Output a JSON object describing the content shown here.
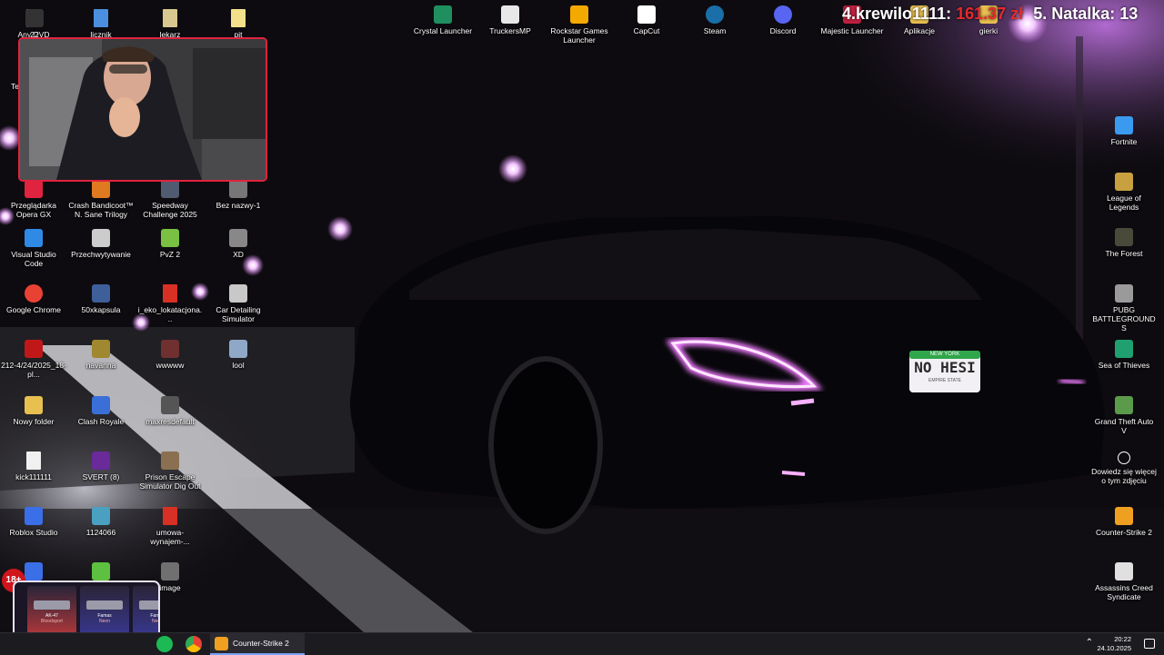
{
  "desktop": {
    "left_icons": [
      {
        "label": "Any DVD",
        "icon": "file-icon",
        "color": "#e8e8e8"
      },
      {
        "label": "licznik",
        "icon": "file-icon",
        "color": "#4a8fe0"
      },
      {
        "label": "lekarz",
        "icon": "file-icon",
        "color": "#d8c890"
      },
      {
        "label": "pit",
        "icon": "file-icon",
        "color": "#f2e18a"
      },
      {
        "label": "22",
        "icon": "image-icon",
        "color": "#333333"
      },
      {
        "label": "Przeglądarka Opera GX",
        "icon": "opera-gx-icon",
        "color": "#e0233e"
      },
      {
        "label": "Crash Bandicoot™ N. Sane Trilogy",
        "icon": "crash-icon",
        "color": "#e07a20"
      },
      {
        "label": "Speedway Challenge 2025",
        "icon": "speedway-icon",
        "color": "#505a70"
      },
      {
        "label": "Bez nazwy-1",
        "icon": "image-icon",
        "color": "#777777"
      },
      {
        "label": "Visual Studio Code",
        "icon": "vscode-icon",
        "color": "#2f8ae6"
      },
      {
        "label": "Przechwytywanie",
        "icon": "image-icon",
        "color": "#cccccc"
      },
      {
        "label": "PvZ 2",
        "icon": "pvz-icon",
        "color": "#7ac043"
      },
      {
        "label": "XD",
        "icon": "image-icon",
        "color": "#888888"
      },
      {
        "label": "Google Chrome",
        "icon": "chrome-icon",
        "color": "#e94235"
      },
      {
        "label": "50xkapsula",
        "icon": "image-icon",
        "color": "#3f5f9a"
      },
      {
        "label": "i_eko_lokatacjona...",
        "icon": "pdf-icon",
        "color": "#d93025"
      },
      {
        "label": "Car Detailing Simulator",
        "icon": "car-detailing-icon",
        "color": "#c8c8c8"
      },
      {
        "label": "212-4/24/2025_18-pl...",
        "icon": "video-icon",
        "color": "#c01818"
      },
      {
        "label": "navanna",
        "icon": "image-icon",
        "color": "#a08830"
      },
      {
        "label": "wwwww",
        "icon": "image-icon",
        "color": "#703030"
      },
      {
        "label": "lool",
        "icon": "image-icon",
        "color": "#90a8c8"
      },
      {
        "label": "Nowy folder",
        "icon": "folder-icon",
        "color": "#e8c050"
      },
      {
        "label": "Clash Royale",
        "icon": "clash-royale-icon",
        "color": "#3a6fd8"
      },
      {
        "label": "maxresdefault",
        "icon": "image-icon",
        "color": "#555555"
      },
      {
        "label": "kick111111",
        "icon": "file-icon",
        "color": "#f0f0f0"
      },
      {
        "label": "SVERT (8)",
        "icon": "image-icon",
        "color": "#6a2a9a"
      },
      {
        "label": "Prison Escape Simulator Dig Out",
        "icon": "prison-escape-icon",
        "color": "#8a7050"
      },
      {
        "label": "Roblox Studio",
        "icon": "roblox-studio-icon",
        "color": "#3a6fe8"
      },
      {
        "label": "1124066",
        "icon": "image-icon",
        "color": "#4aa0c0"
      },
      {
        "label": "umowa-wynajem-...",
        "icon": "pdf-icon",
        "color": "#d93025"
      },
      {
        "label": "",
        "icon": "roblox-studio-icon",
        "color": "#3a6fe8"
      },
      {
        "label": "",
        "icon": "bluestacks-icon",
        "color": "#5ec040"
      },
      {
        "label": "image",
        "icon": "image-icon",
        "color": "#707070"
      }
    ],
    "partial_label": "Te",
    "top_icons": [
      {
        "label": "Crystal Launcher",
        "icon": "crystal-launcher-icon",
        "color": "#1f8f5f"
      },
      {
        "label": "TruckersMP",
        "icon": "truckersmp-icon",
        "color": "#e8e8e8"
      },
      {
        "label": "Rockstar Games Launcher",
        "icon": "rockstar-icon",
        "color": "#f4a900"
      },
      {
        "label": "CapCut",
        "icon": "capcut-icon",
        "color": "#ffffff"
      },
      {
        "label": "Steam",
        "icon": "steam-icon",
        "color": "#1b6fa8"
      },
      {
        "label": "Discord",
        "icon": "discord-icon",
        "color": "#5865f2"
      },
      {
        "label": "Majestic Launcher",
        "icon": "majestic-icon",
        "color": "#c02040"
      },
      {
        "label": "Aplikacje",
        "icon": "folder-icon",
        "color": "#e8c050"
      },
      {
        "label": "gierki",
        "icon": "folder-icon",
        "color": "#e8c050"
      }
    ],
    "right_icons": [
      {
        "label": "Fortnite",
        "icon": "fortnite-icon",
        "color": "#3a9af0"
      },
      {
        "label": "League of Legends",
        "icon": "lol-icon",
        "color": "#c8a040"
      },
      {
        "label": "The Forest",
        "icon": "the-forest-icon",
        "color": "#4a4a3a"
      },
      {
        "label": "PUBG BATTLEGROUNDS",
        "icon": "pubg-icon",
        "color": "#9a9a9a"
      },
      {
        "label": "Sea of Thieves",
        "icon": "sea-of-thieves-icon",
        "color": "#20a070"
      },
      {
        "label": "Grand Theft Auto V",
        "icon": "gta-icon",
        "color": "#5a9a4a"
      },
      {
        "label": "Dowiedz się więcej o tym zdjęciu",
        "icon": "camera-info-icon",
        "color": "#ffffff"
      },
      {
        "label": "Counter-Strike 2",
        "icon": "cs2-icon",
        "color": "#f0a020"
      },
      {
        "label": "Assassins Creed Syndicate",
        "icon": "assassins-creed-icon",
        "color": "#e0e0e0"
      }
    ]
  },
  "overlay": {
    "alert_rank": "4.",
    "alert_user": "krewilo1111:",
    "alert_amount": "161.37 zł",
    "alert_next": "5. Natalka: 13",
    "plate_top": "NEW YORK",
    "plate_text": "NO HESI",
    "plate_bottom": "EMPIRE STATE",
    "age_badge": "18+",
    "cases": [
      {
        "name": "AK-47",
        "tag": "Bloodsport",
        "color": "#c23a3a"
      },
      {
        "name": "Famas",
        "tag": "Neon",
        "color": "#3a3a9a"
      },
      {
        "name": "Famas",
        "tag": "Neon",
        "color": "#3a3a9a"
      }
    ]
  },
  "taskbar": {
    "app_label": "Counter-Strike 2",
    "time": "20:22",
    "date": "24.10.2025"
  }
}
